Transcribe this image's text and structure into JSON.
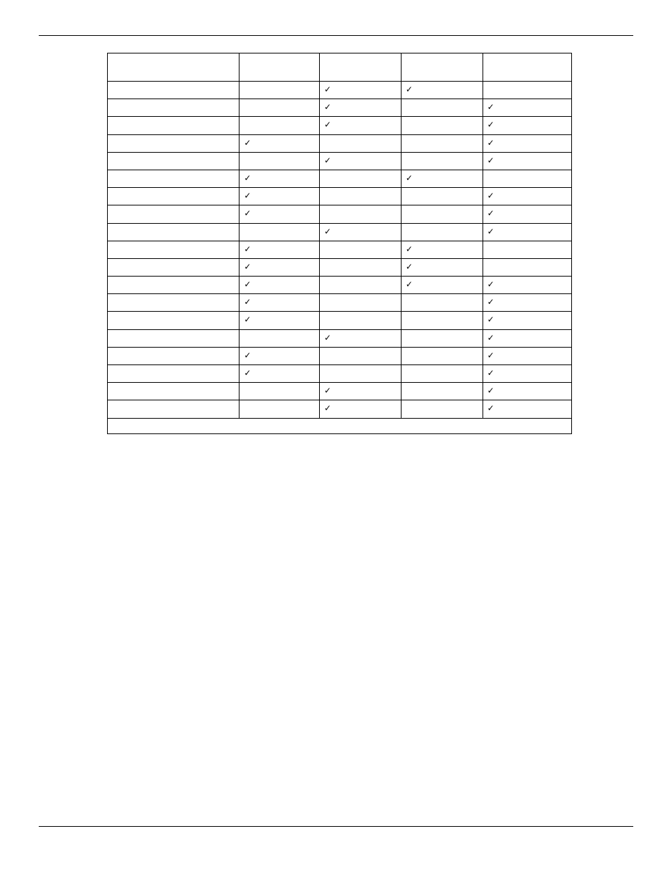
{
  "check_glyph": "✓",
  "table": {
    "columns": [
      "",
      "",
      "",
      "",
      ""
    ],
    "rows": [
      {
        "name": "",
        "cols": [
          false,
          true,
          true,
          false
        ]
      },
      {
        "name": "",
        "cols": [
          false,
          true,
          false,
          true
        ]
      },
      {
        "name": "",
        "cols": [
          false,
          true,
          false,
          true
        ]
      },
      {
        "name": "",
        "cols": [
          true,
          false,
          false,
          true
        ]
      },
      {
        "name": "",
        "cols": [
          false,
          true,
          false,
          true
        ]
      },
      {
        "name": "",
        "cols": [
          true,
          false,
          true,
          false
        ]
      },
      {
        "name": "",
        "cols": [
          true,
          false,
          false,
          true
        ]
      },
      {
        "name": "",
        "cols": [
          true,
          false,
          false,
          true
        ]
      },
      {
        "name": "",
        "cols": [
          false,
          true,
          false,
          true
        ]
      },
      {
        "name": "",
        "cols": [
          true,
          false,
          true,
          false
        ]
      },
      {
        "name": "",
        "cols": [
          true,
          false,
          true,
          false
        ]
      },
      {
        "name": "",
        "cols": [
          true,
          false,
          true,
          true
        ]
      },
      {
        "name": "",
        "cols": [
          true,
          false,
          false,
          true
        ]
      },
      {
        "name": "",
        "cols": [
          true,
          false,
          false,
          true
        ]
      },
      {
        "name": "",
        "cols": [
          false,
          true,
          false,
          true
        ]
      },
      {
        "name": "",
        "cols": [
          true,
          false,
          false,
          true
        ]
      },
      {
        "name": "",
        "cols": [
          true,
          false,
          false,
          true
        ]
      },
      {
        "name": "",
        "cols": [
          false,
          true,
          false,
          true
        ]
      },
      {
        "name": "",
        "cols": [
          false,
          true,
          false,
          true
        ]
      }
    ],
    "footer": ""
  }
}
